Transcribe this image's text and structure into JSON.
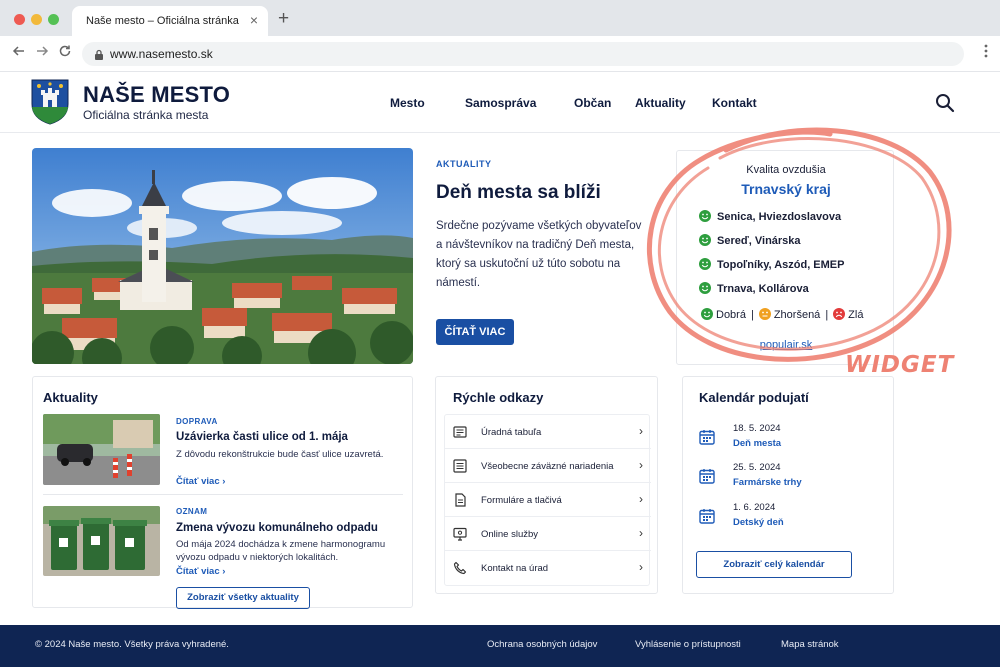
{
  "browser": {
    "tab_title": "Naše mesto – Oficiálna stránka",
    "tab_close": "×",
    "new_tab": "+",
    "url": "www.nasemesto.sk"
  },
  "header": {
    "site_name": "NAŠE MESTO",
    "site_subtitle": "Oficiálna stránka mesta",
    "nav": [
      "Mesto",
      "Samospráva",
      "Občan",
      "Aktuality",
      "Kontakt"
    ]
  },
  "hero": {
    "tag": "AKTUALITY",
    "title": "Deň mesta sa blíži",
    "text": "Srdečne pozývame všetkých obyvateľov a návštevníkov na tradičný Deň mesta, ktorý sa uskutoční už túto sobotu na námestí.",
    "button": "ČÍTAŤ VIAC"
  },
  "air_widget": {
    "title": "Kvalita ovzdušia",
    "region": "Trnavský kraj",
    "stations": [
      {
        "name": "Senica, Hviezdoslavova",
        "status": "good"
      },
      {
        "name": "Sereď, Vinárska",
        "status": "good"
      },
      {
        "name": "Topoľníky, Aszód, EMEP",
        "status": "good"
      },
      {
        "name": "Trnava, Kollárova",
        "status": "good"
      }
    ],
    "legend": {
      "good": "Dobrá",
      "worse": "Zhoršená",
      "bad": "Zlá",
      "separator": "|"
    },
    "link": "populair.sk",
    "colors": {
      "good": "#2e9e3e",
      "worse": "#f0a020",
      "bad": "#e23b3b"
    }
  },
  "annotation": {
    "label": "WIDGET",
    "color": "#ee8273"
  },
  "news": {
    "title": "Aktuality",
    "items": [
      {
        "tag": "DOPRAVA",
        "title": "Uzávierka časti ulice od 1. mája",
        "text": "Z dôvodu rekonštrukcie bude časť ulice uzavretá.",
        "more": "Čítať viac"
      },
      {
        "tag": "OZNAM",
        "title": "Zmena vývozu komunálneho odpadu",
        "text": "Od mája 2024 dochádza k zmene harmonogramu vývozu odpadu v niektorých lokalitách.",
        "more": "Čítať viac"
      }
    ],
    "all_button": "Zobraziť všetky aktuality"
  },
  "quick_links": {
    "title": "Rýchle odkazy",
    "items": [
      {
        "label": "Úradná tabuľa",
        "icon": "notice-board-icon"
      },
      {
        "label": "Všeobecne záväzné nariadenia",
        "icon": "regulations-icon"
      },
      {
        "label": "Formuláre a tlačivá",
        "icon": "document-icon"
      },
      {
        "label": "Online služby",
        "icon": "monitor-icon"
      },
      {
        "label": "Kontakt na úrad",
        "icon": "phone-icon"
      }
    ]
  },
  "calendar": {
    "title": "Kalendár podujatí",
    "events": [
      {
        "date": "18. 5. 2024",
        "name": "Deň mesta"
      },
      {
        "date": "25. 5. 2024",
        "name": "Farmárske trhy"
      },
      {
        "date": "1. 6. 2024",
        "name": "Detský deň"
      }
    ],
    "button": "Zobraziť celý kalendár"
  },
  "footer": {
    "copyright": "© 2024 Naše mesto. Všetky práva vyhradené.",
    "links": [
      "Ochrana osobných údajov",
      "Vyhlásenie o prístupnosti",
      "Mapa stránok"
    ]
  },
  "colors": {
    "brand_blue": "#1a4fa3",
    "link_blue": "#1e5bb8",
    "footer_bg": "#0f2553"
  }
}
